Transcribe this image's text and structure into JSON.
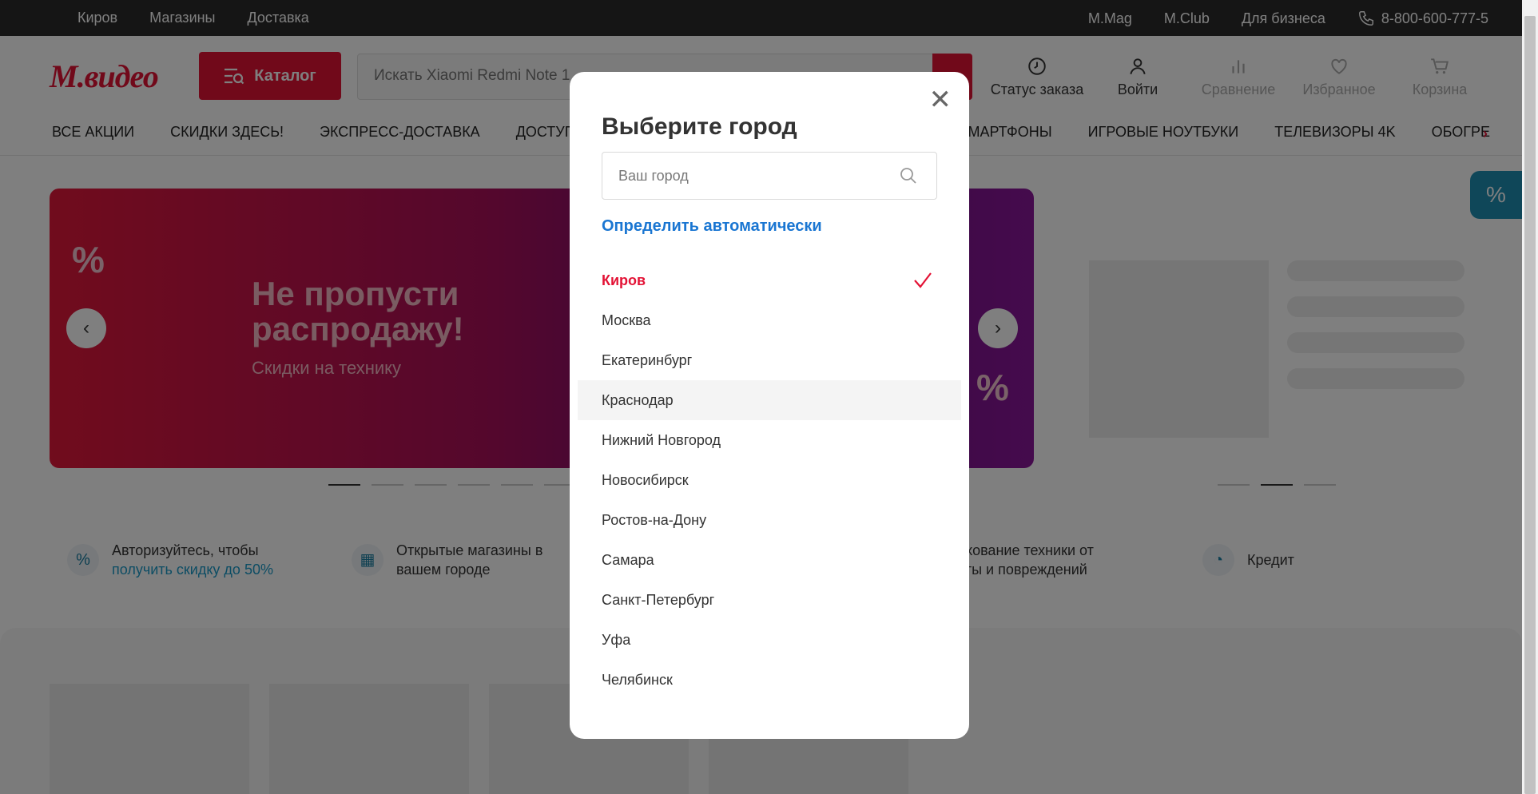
{
  "topbar": {
    "city": "Киров",
    "stores": "Магазины",
    "delivery": "Доставка",
    "mmag": "M.Mag",
    "mclub": "M.Club",
    "business": "Для бизнеса",
    "phone": "8-800-600-777-5"
  },
  "header": {
    "logo": "М.видео",
    "catalog": "Каталог",
    "search_placeholder": "Искать Xiaomi Redmi Note 1",
    "order_status": "Статус заказа",
    "login": "Войти",
    "compare": "Сравнение",
    "favorites": "Избранное",
    "cart": "Корзина"
  },
  "nav": [
    "ВСЕ АКЦИИ",
    "СКИДКИ ЗДЕСЬ!",
    "ЭКСПРЕСС-ДОСТАВКА",
    "ДОСТУПНЫ",
    "",
    "СМАРТФОНЫ",
    "ИГРОВЫЕ НОУТБУКИ",
    "ТЕЛЕВИЗОРЫ 4K",
    "ОБОГРЕ"
  ],
  "banner": {
    "title_line1": "Не пропусти",
    "title_line2": "распродажу!",
    "subtitle": "Скидки на технику"
  },
  "info": {
    "auth_text": "Авторизуйтесь, чтобы",
    "auth_link": "получить скидку до 50%",
    "stores_line1": "Открытые магазины в",
    "stores_line2": "вашем городе",
    "insurance_line1": "трахование техники от",
    "insurance_line2": "траты и повреждений",
    "credit": "Кредит"
  },
  "modal": {
    "title": "Выберите город",
    "input_placeholder": "Ваш город",
    "auto_detect": "Определить автоматически",
    "cities": [
      "Киров",
      "Москва",
      "Екатеринбург",
      "Краснодар",
      "Нижний Новгород",
      "Новосибирск",
      "Ростов-на-Дону",
      "Самара",
      "Санкт-Петербург",
      "Уфа",
      "Челябинск"
    ],
    "selected_city": "Киров",
    "hovered_city": "Краснодар"
  },
  "colors": {
    "brand": "#e31235",
    "link": "#1a76d2",
    "teal": "#1f8fb3"
  }
}
